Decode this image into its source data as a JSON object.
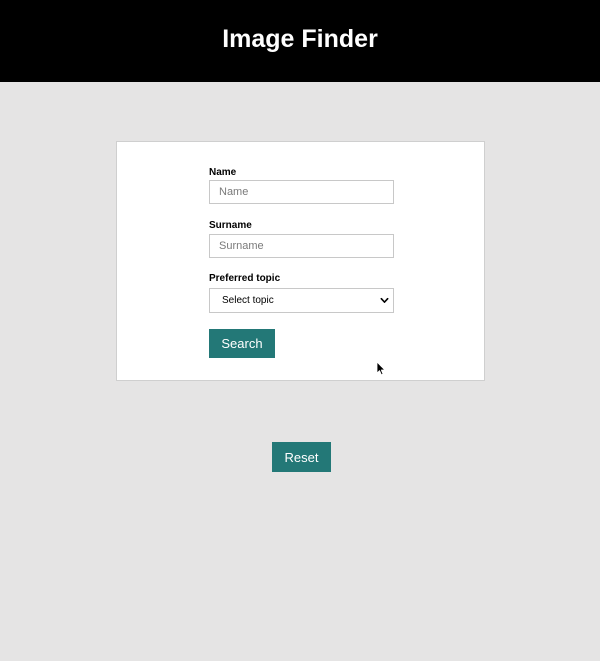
{
  "header": {
    "title": "Image Finder"
  },
  "form": {
    "name": {
      "label": "Name",
      "value": "",
      "placeholder": "Name"
    },
    "surname": {
      "label": "Surname",
      "value": "",
      "placeholder": "Surname"
    },
    "topic": {
      "label": "Preferred topic",
      "selected": "Select topic"
    },
    "search_label": "Search"
  },
  "reset_label": "Reset",
  "colors": {
    "header_bg": "#000000",
    "page_bg": "#e5e4e4",
    "button_bg": "#237877"
  },
  "icons": {
    "select": "chevron-down-icon",
    "pointer": "mouse-cursor-icon"
  }
}
